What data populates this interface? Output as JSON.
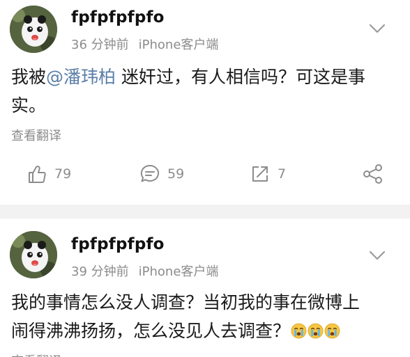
{
  "posts": [
    {
      "username": "fpfpfpfpfo",
      "time": "36 分钟前",
      "source": "iPhone客户端",
      "content_before": "我被",
      "mention": "@潘玮柏",
      "content_line1_after": " 迷奸过，有人相信吗？可这是事",
      "content_line2": "实。",
      "translate_label": "查看翻译",
      "actions": {
        "likes": "79",
        "comments": "59",
        "reposts": "7"
      }
    },
    {
      "username": "fpfpfpfpfo",
      "time": "39 分钟前",
      "source": "iPhone客户端",
      "content_line1": "我的事情怎么没人调查？当初我的事在微博上",
      "content_line2": "闹得沸沸扬扬，怎么没见人去调查？",
      "emojis": [
        "crying-face",
        "crying-face",
        "crying-face"
      ],
      "translate_label": "查看翻译"
    }
  ],
  "colors": {
    "mention": "#5b7fa8",
    "meta": "#8c8c8c",
    "separator": "#f2f2f2"
  }
}
